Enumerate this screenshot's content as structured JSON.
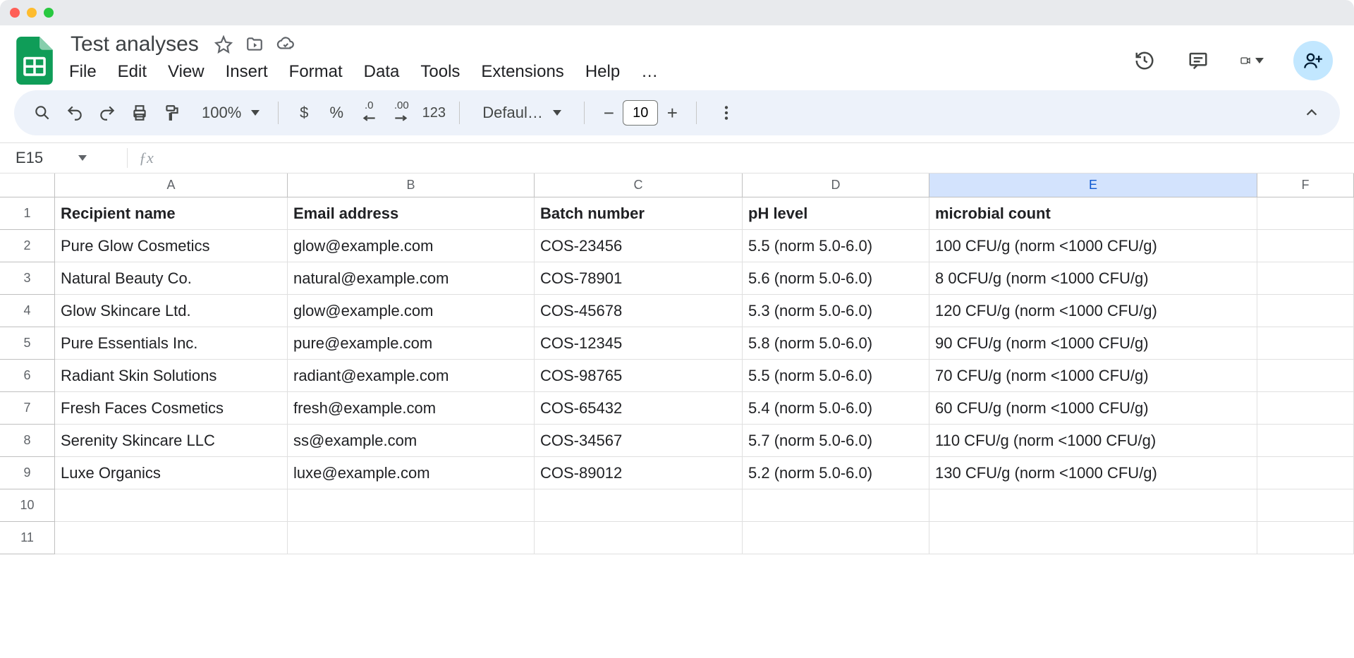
{
  "doc_title": "Test analyses",
  "menu": {
    "file": "File",
    "edit": "Edit",
    "view": "View",
    "insert": "Insert",
    "format": "Format",
    "data": "Data",
    "tools": "Tools",
    "extensions": "Extensions",
    "help": "Help",
    "more": "…"
  },
  "toolbar": {
    "zoom": "100%",
    "dollar": "$",
    "percent": "%",
    "dec_dec": ".0",
    "inc_dec": ".00",
    "num123": "123",
    "font": "Defaul…",
    "font_size": "10"
  },
  "namebox": "E15",
  "columns": [
    "A",
    "B",
    "C",
    "D",
    "E",
    "F"
  ],
  "selected_col": "E",
  "headers": {
    "A": "Recipient name",
    "B": "Email address",
    "C": "Batch number",
    "D": "pH level",
    "E": "microbial count"
  },
  "rows": [
    {
      "A": "Pure Glow Cosmetics",
      "B": "glow@example.com",
      "C": "COS-23456",
      "D": "5.5 (norm 5.0-6.0)",
      "E": "100 CFU/g (norm <1000 CFU/g)"
    },
    {
      "A": "Natural Beauty Co.",
      "B": "natural@example.com",
      "C": "COS-78901",
      "D": "5.6  (norm 5.0-6.0)",
      "E": "8 0CFU/g (norm <1000 CFU/g)"
    },
    {
      "A": "Glow Skincare Ltd.",
      "B": "glow@example.com",
      "C": "COS-45678",
      "D": "5.3  (norm 5.0-6.0)",
      "E": "120 CFU/g (norm <1000 CFU/g)"
    },
    {
      "A": "Pure Essentials Inc.",
      "B": "pure@example.com",
      "C": "COS-12345",
      "D": "5.8  (norm 5.0-6.0)",
      "E": "90 CFU/g (norm <1000 CFU/g)"
    },
    {
      "A": "Radiant Skin Solutions",
      "B": "radiant@example.com",
      "C": "COS-98765",
      "D": "5.5  (norm 5.0-6.0)",
      "E": "70 CFU/g (norm <1000 CFU/g)"
    },
    {
      "A": "Fresh Faces Cosmetics",
      "B": "fresh@example.com",
      "C": "COS-65432",
      "D": "5.4  (norm 5.0-6.0)",
      "E": "60 CFU/g (norm <1000 CFU/g)"
    },
    {
      "A": "Serenity Skincare LLC",
      "B": "ss@example.com",
      "C": "COS-34567",
      "D": "5.7  (norm 5.0-6.0)",
      "E": "110 CFU/g (norm <1000 CFU/g)"
    },
    {
      "A": "Luxe Organics",
      "B": "luxe@example.com",
      "C": "COS-89012",
      "D": "5.2  (norm 5.0-6.0)",
      "E": "130 CFU/g (norm <1000 CFU/g)"
    }
  ],
  "empty_rows": [
    10,
    11
  ]
}
